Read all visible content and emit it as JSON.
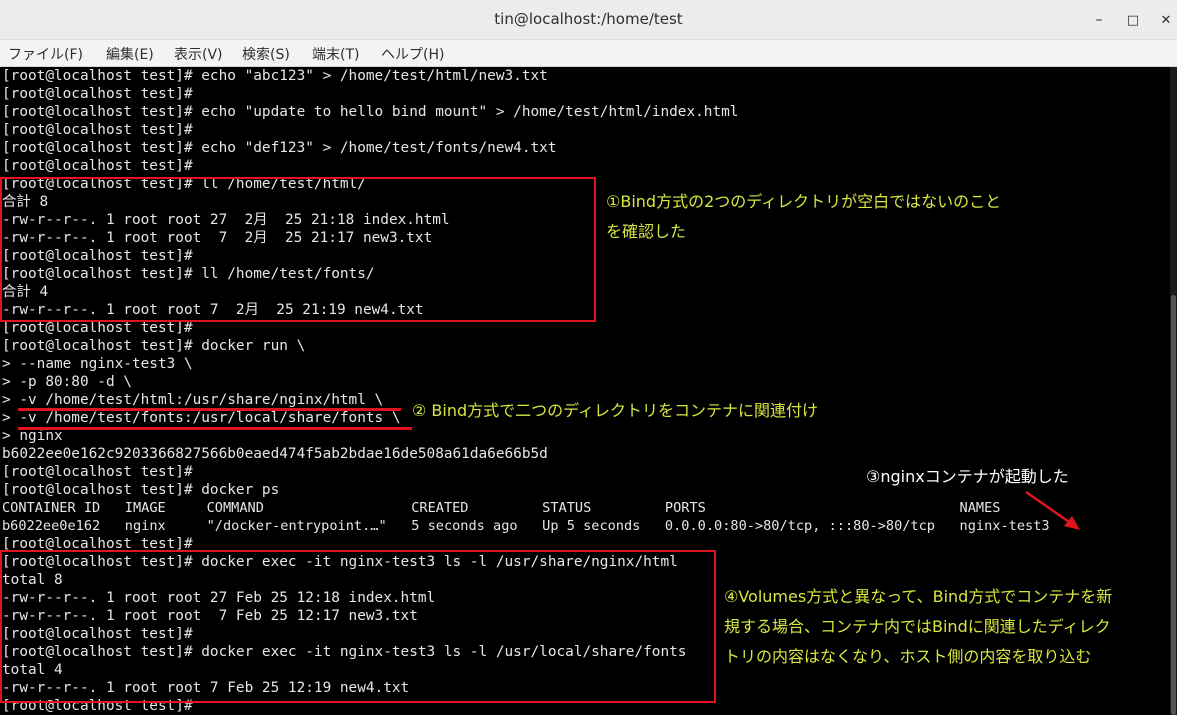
{
  "window": {
    "title": "tin@localhost:/home/test",
    "minimize": "–",
    "maximize": "□",
    "close": "✕"
  },
  "menu": [
    "ファイル(F)",
    "編集(E)",
    "表示(V)",
    "検索(S)",
    "端末(T)",
    "ヘルプ(H)"
  ],
  "lines": [
    "[root@localhost test]# echo \"abc123\" > /home/test/html/new3.txt",
    "[root@localhost test]#",
    "[root@localhost test]# echo \"update to hello bind mount\" > /home/test/html/index.html",
    "[root@localhost test]#",
    "[root@localhost test]# echo \"def123\" > /home/test/fonts/new4.txt",
    "[root@localhost test]#",
    "[root@localhost test]# ll /home/test/html/",
    "合計 8",
    "-rw-r--r--. 1 root root 27  2月  25 21:18 index.html",
    "-rw-r--r--. 1 root root  7  2月  25 21:17 new3.txt",
    "[root@localhost test]#",
    "[root@localhost test]# ll /home/test/fonts/",
    "合計 4",
    "-rw-r--r--. 1 root root 7  2月  25 21:19 new4.txt",
    "[root@localhost test]#",
    "[root@localhost test]# docker run \\",
    "> --name nginx-test3 \\",
    "> -p 80:80 -d \\",
    "> -v /home/test/html:/usr/share/nginx/html \\",
    "> -v /home/test/fonts:/usr/local/share/fonts \\",
    "> nginx",
    "b6022ee0e162c9203366827566b0eaed474f5ab2bdae16de508a61da6e66b5d",
    "[root@localhost test]#",
    "[root@localhost test]# docker ps",
    "CONTAINER ID   IMAGE     COMMAND                  CREATED         STATUS         PORTS                               NAMES",
    "b6022ee0e162   nginx     \"/docker-entrypoint.…\"   5 seconds ago   Up 5 seconds   0.0.0.0:80->80/tcp, :::80->80/tcp   nginx-test3",
    "[root@localhost test]#",
    "[root@localhost test]# docker exec -it nginx-test3 ls -l /usr/share/nginx/html",
    "total 8",
    "-rw-r--r--. 1 root root 27 Feb 25 12:18 index.html",
    "-rw-r--r--. 1 root root  7 Feb 25 12:17 new3.txt",
    "[root@localhost test]#",
    "[root@localhost test]# docker exec -it nginx-test3 ls -l /usr/local/share/fonts",
    "total 4",
    "-rw-r--r--. 1 root root 7 Feb 25 12:19 new4.txt",
    "[root@localhost test]#"
  ],
  "annotations": {
    "note1_line1": "①Bind方式の2つのディレクトリが空白ではないのこと",
    "note1_line2": "を確認した",
    "note2": "② Bind方式で二つのディレクトリをコンテナに関連付け",
    "note3": "③nginxコンテナが起動した",
    "note4_line1": "④Volumes方式と異なって、Bind方式でコンテナを新",
    "note4_line2": "規する場合、コンテナ内ではBindに関連したディレク",
    "note4_line3": "トリの内容はなくなり、ホスト側の内容を取り込む"
  },
  "colors": {
    "terminal_bg": "#000000",
    "terminal_fg": "#e6e6e6",
    "highlight_red": "#e0141e",
    "note_yellow": "#d8e640"
  }
}
